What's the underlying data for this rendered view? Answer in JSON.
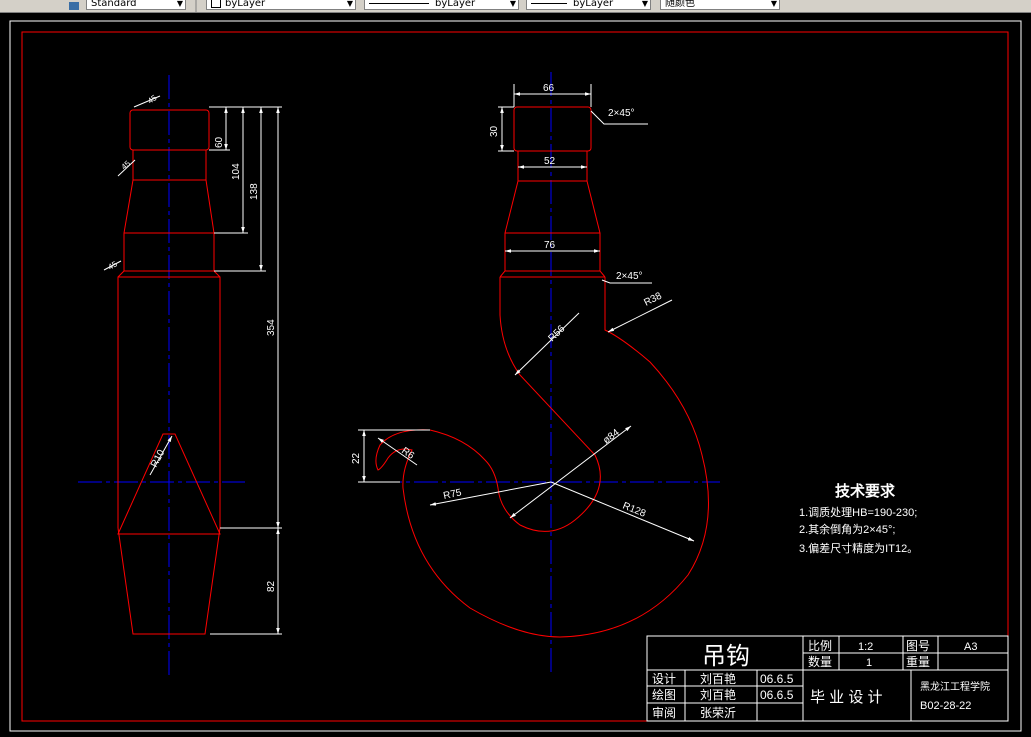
{
  "toolbar": {
    "text_style": "Standard",
    "layer": "byLayer",
    "linetype": "byLayer",
    "lineweight": "byLayer",
    "color": "随颜色"
  },
  "dims": {
    "d_chamfer_top_left": "45",
    "d_chamfer_mid_left": "45",
    "d_chamfer_low_left": "45",
    "d60": "60",
    "d104": "104",
    "d138": "138",
    "d354": "354",
    "d82": "82",
    "r10": "R10",
    "d66": "66",
    "d30": "30",
    "d52": "52",
    "d76": "76",
    "chamfer_top": "2×45°",
    "chamfer_mid": "2×45°",
    "r38": "R38",
    "r56": "R56",
    "d84": "ø84",
    "r6": "R6",
    "d22": "22",
    "r75": "R75",
    "r128": "R128"
  },
  "notes": {
    "title": "技术要求",
    "line1": "1.调质处理HB=190-230;",
    "line2": "2.其余倒角为2×45°;",
    "line3": "3.偏差尺寸精度为IT12。"
  },
  "titleblock": {
    "part_name": "吊钩",
    "scale_label": "比例",
    "scale_value": "1:2",
    "drawing_no_label": "图号",
    "drawing_no_value": "A3",
    "qty_label": "数量",
    "qty_value": "1",
    "weight_label": "重量",
    "design_label": "设计",
    "design_name": "刘百艳",
    "design_date": "06.6.5",
    "draw_label": "绘图",
    "draw_name": "刘百艳",
    "draw_date": "06.6.5",
    "review_label": "审阅",
    "review_name": "张荣沂",
    "project": "毕 业 设 计",
    "school": "黑龙江工程学院",
    "code": "B02-28-22"
  },
  "colors": {
    "background": "#000000",
    "outline": "#ff0000",
    "centerline": "#0000ff",
    "dimension": "#ffffff"
  }
}
